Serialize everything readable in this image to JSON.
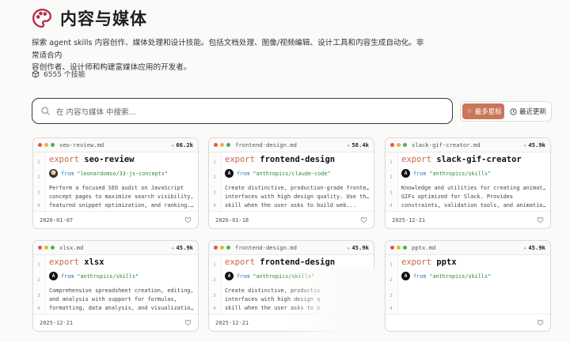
{
  "header": {
    "title": "内容与媒体"
  },
  "description": [
    "探索 agent skills 内容创作、媒体处理和设计技能。包括文档处理、图像/视频编辑、设计工具和内容生成自动化。非常适合内",
    "容创作者、设计师和构建富媒体应用的开发者。"
  ],
  "skill_count": "6555 个技能",
  "search": {
    "placeholder": "在 内容与媒体 中搜索..."
  },
  "sort": {
    "most_stars": "最多星标",
    "recent": "最近更新"
  },
  "colors": {
    "accent": "#c9765a",
    "dot_red": "#e5534b",
    "dot_yellow": "#e8b339",
    "dot_green": "#4caf50"
  },
  "cards": [
    {
      "file": "seo-review.md",
      "stars": "66.2k",
      "kw": "export",
      "name": "seo-review",
      "from_kw": "from",
      "from": "\"leonardomso/33-js-concepts\"",
      "lines": [
        "Perform a focused SEO audit on JavaScript",
        "concept pages to maximize search visibility,",
        "featured snippet optimization, and ranking..."
      ],
      "date": "2026-01-07",
      "avatar": "person"
    },
    {
      "file": "frontend-design.md",
      "stars": "58.4k",
      "kw": "export",
      "name": "frontend-design",
      "from_kw": "from",
      "from": "\"anthropics/claude-code\"",
      "lines": [
        "Create distinctive, production-grade frontend",
        "interfaces with high design quality. Use this",
        "skill when the user asks to build web..."
      ],
      "date": "2026-01-18",
      "avatar": "anthropic"
    },
    {
      "file": "slack-gif-creator.md",
      "stars": "45.9k",
      "kw": "export",
      "name": "slack-gif-creator",
      "from_kw": "from",
      "from": "\"anthropics/skills\"",
      "lines": [
        "Knowledge and utilities for creating animated",
        "GIFs optimized for Slack. Provides",
        "constraints, validation tools, and animation..."
      ],
      "date": "2025-12-21",
      "avatar": "anthropic"
    },
    {
      "file": "xlsx.md",
      "stars": "45.9k",
      "kw": "export",
      "name": "xlsx",
      "from_kw": "from",
      "from": "\"anthropics/skills\"",
      "lines": [
        "Comprehensive spreadsheet creation, editing,",
        "and analysis with support for formulas,",
        "formatting, data analysis, and visualization...."
      ],
      "date": "2025-12-21",
      "avatar": "anthropic"
    },
    {
      "file": "frontend-design.md",
      "stars": "45.9k",
      "kw": "export",
      "name": "frontend-design",
      "from_kw": "from",
      "from": "\"anthropics/skills\"",
      "lines": [
        "Create distinctive, productio",
        "interfaces with high design q",
        "skill when the user asks to b"
      ],
      "date": "2025-12-21",
      "avatar": "anthropic"
    },
    {
      "file": "pptx.md",
      "stars": "45.9k",
      "kw": "export",
      "name": "pptx",
      "from_kw": "from",
      "from": "\"anthropics/skills\"",
      "lines": [
        "",
        "",
        ""
      ],
      "date": "",
      "avatar": "anthropic"
    }
  ]
}
